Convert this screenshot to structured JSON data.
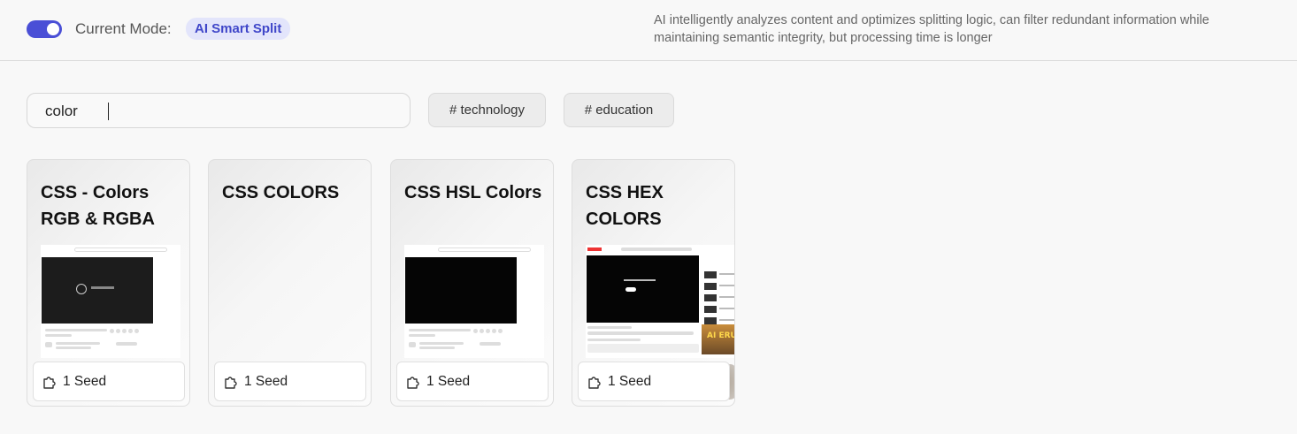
{
  "header": {
    "toggle_on": true,
    "mode_label": "Current Mode:",
    "mode_value": "AI Smart Split",
    "description": "AI intelligently analyzes content and optimizes splitting logic, can filter redundant information while maintaining semantic integrity, but processing time is longer"
  },
  "search": {
    "value": "color"
  },
  "tags": [
    {
      "label": "# technology"
    },
    {
      "label": "# education"
    }
  ],
  "cards": [
    {
      "title": "CSS - Colors RGB & RGBA",
      "seed_label": "1 Seed"
    },
    {
      "title": "CSS COLORS",
      "seed_label": "1 Seed"
    },
    {
      "title": "CSS HSL Colors",
      "seed_label": "1 Seed"
    },
    {
      "title": "CSS HEX COLORS",
      "seed_label": "1 Seed"
    }
  ],
  "thumb4": {
    "poster_text": "AI ERU"
  },
  "colors": {
    "accent": "#4a4fd6",
    "badge_bg": "#e3e5fb",
    "badge_text": "#4047c9"
  },
  "icons": {
    "seed": "puzzle-icon"
  }
}
